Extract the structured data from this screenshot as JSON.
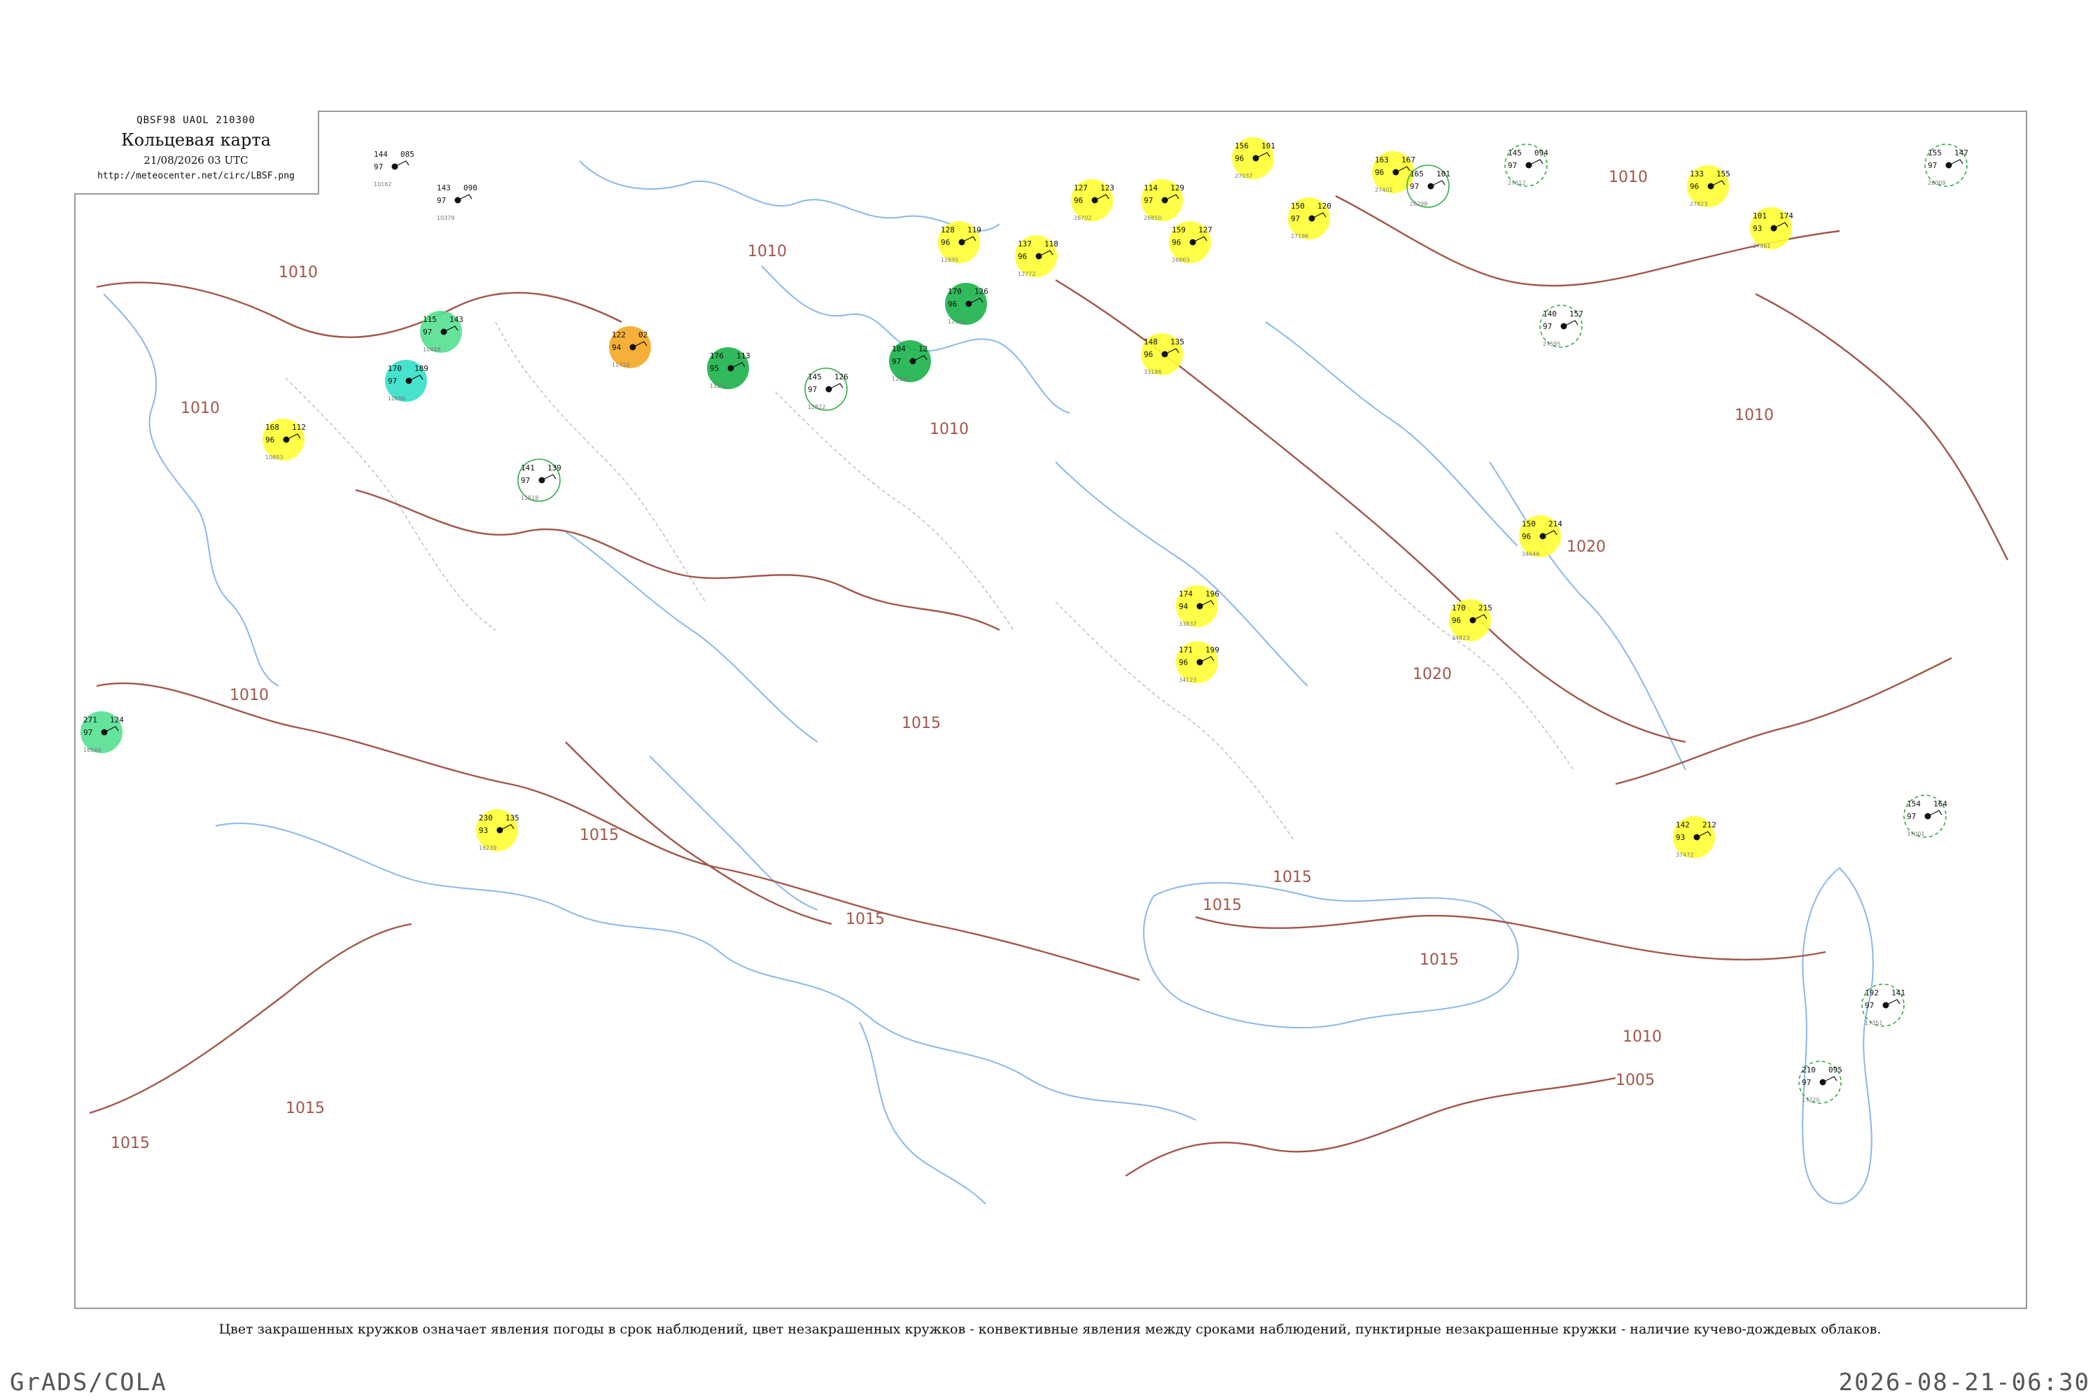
{
  "header": {
    "code": "QBSF98  UAOL  210300",
    "title": "Кольцевая карта",
    "date": "21/08/2026 03 UTC",
    "url": "http://meteocenter.net/circ/LBSF.png"
  },
  "legend_note": "Цвет закрашенных кружков означает явления погоды в срок наблюдений, цвет незакрашенных кружков - конвективные явления между сроками наблюдений, пунктирные незакрашенные кружки - наличие кучево-дождевых облаков.",
  "footer": {
    "left": "GrADS/COLA",
    "right": "2026-08-21-06:30"
  },
  "colors": {
    "isobar": "#a0564a",
    "coast": "#8ab8e8",
    "border": "#b0b0b0",
    "rain_green": "#19b34a",
    "yellow": "#ffff33",
    "orange": "#f5a623",
    "teal": "#33e0c8",
    "light_green": "#55e090",
    "dashed_ring": "#33aa44"
  },
  "isobar_labels": [
    "1010",
    "1010",
    "1010",
    "1010",
    "1010",
    "1010",
    "1010",
    "1015",
    "1015",
    "1015",
    "1015",
    "1015",
    "1015",
    "1015",
    "1015",
    "1020",
    "1020",
    "1005",
    "1010"
  ],
  "stations": [
    {
      "t": "144",
      "p": "085",
      "d": "97",
      "id": "10162",
      "marker": "none"
    },
    {
      "t": "143",
      "p": "090",
      "d": "97",
      "id": "10379",
      "marker": "none"
    },
    {
      "t": "115",
      "p": "143",
      "d": "97",
      "id": "10488",
      "marker": "light_green"
    },
    {
      "t": "170",
      "p": "189",
      "d": "97",
      "id": "10696",
      "marker": "teal"
    },
    {
      "t": "168",
      "p": "112",
      "d": "96",
      "id": "10803",
      "marker": "yellow"
    },
    {
      "t": "122",
      "p": "02",
      "d": "94",
      "id": "11710",
      "marker": "orange"
    },
    {
      "t": "176",
      "p": "113",
      "d": "95",
      "id": "11952",
      "marker": "rain_green"
    },
    {
      "t": "184",
      "p": "12",
      "d": "97",
      "id": "12330",
      "marker": "rain_green"
    },
    {
      "t": "170",
      "p": "126",
      "d": "96",
      "id": "12566",
      "marker": "rain_green"
    },
    {
      "t": "128",
      "p": "119",
      "d": "96",
      "id": "12695",
      "marker": "yellow"
    },
    {
      "t": "137",
      "p": "118",
      "d": "96",
      "id": "12772",
      "marker": "yellow"
    },
    {
      "t": "127",
      "p": "123",
      "d": "96",
      "id": "26702",
      "marker": "yellow"
    },
    {
      "t": "114",
      "p": "129",
      "d": "97",
      "id": "26850",
      "marker": "yellow"
    },
    {
      "t": "159",
      "p": "127",
      "d": "96",
      "id": "26863",
      "marker": "yellow"
    },
    {
      "t": "156",
      "p": "101",
      "d": "96",
      "id": "27037",
      "marker": "yellow"
    },
    {
      "t": "150",
      "p": "120",
      "d": "97",
      "id": "27196",
      "marker": "yellow"
    },
    {
      "t": "163",
      "p": "167",
      "d": "96",
      "id": "27402",
      "marker": "yellow"
    },
    {
      "t": "145",
      "p": "094",
      "d": "97",
      "id": "27612",
      "marker": "dashed"
    },
    {
      "t": "133",
      "p": "155",
      "d": "96",
      "id": "27823",
      "marker": "yellow"
    },
    {
      "t": "101",
      "p": "174",
      "d": "93",
      "id": "27961",
      "marker": "yellow"
    },
    {
      "t": "155",
      "p": "147",
      "d": "97",
      "id": "28009",
      "marker": "dashed"
    },
    {
      "t": "148",
      "p": "135",
      "d": "96",
      "id": "33186",
      "marker": "yellow"
    },
    {
      "t": "174",
      "p": "196",
      "d": "94",
      "id": "33837",
      "marker": "yellow"
    },
    {
      "t": "171",
      "p": "199",
      "d": "96",
      "id": "34123",
      "marker": "yellow"
    },
    {
      "t": "170",
      "p": "215",
      "d": "96",
      "id": "34823",
      "marker": "yellow"
    },
    {
      "t": "150",
      "p": "214",
      "d": "96",
      "id": "34646",
      "marker": "yellow"
    },
    {
      "t": "140",
      "p": "157",
      "d": "97",
      "id": "27595",
      "marker": "dashed"
    },
    {
      "t": "142",
      "p": "212",
      "d": "93",
      "id": "37472",
      "marker": "yellow"
    },
    {
      "t": "271",
      "p": "124",
      "d": "97",
      "id": "16560",
      "marker": "light_green"
    },
    {
      "t": "230",
      "p": "135",
      "d": "93",
      "id": "16239",
      "marker": "yellow"
    },
    {
      "t": "210",
      "p": "095",
      "d": "97",
      "id": "17220",
      "marker": "dashed"
    },
    {
      "t": "192",
      "p": "141",
      "d": "97",
      "id": "17351",
      "marker": "dashed"
    },
    {
      "t": "154",
      "p": "164",
      "d": "97",
      "id": "37001",
      "marker": "dashed"
    },
    {
      "t": "141",
      "p": "139",
      "d": "97",
      "id": "11518",
      "marker": "ring"
    },
    {
      "t": "145",
      "p": "126",
      "d": "97",
      "id": "12822",
      "marker": "ring"
    },
    {
      "t": "165",
      "p": "101",
      "d": "97",
      "id": "26298",
      "marker": "ring"
    }
  ]
}
